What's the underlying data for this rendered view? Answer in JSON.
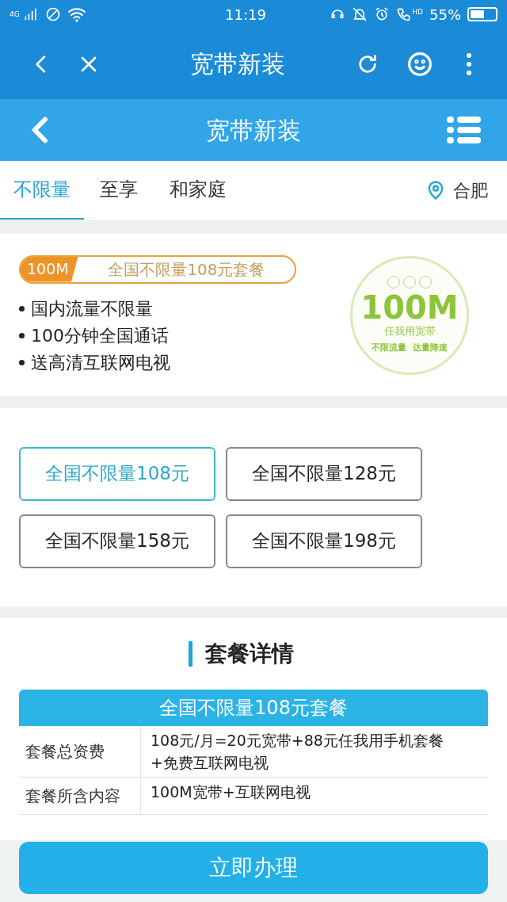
{
  "status_bar": {
    "network": "4G",
    "time": "11:19",
    "battery": "55%",
    "hd": "HD"
  },
  "app_bar": {
    "title": "宽带新装"
  },
  "page_header": {
    "title": "宽带新装"
  },
  "tabs": [
    {
      "label": "不限量",
      "selected": true
    },
    {
      "label": "至享",
      "selected": false
    },
    {
      "label": "和家庭",
      "selected": false
    }
  ],
  "location": "合肥",
  "banner": {
    "speed_tag": "100M",
    "plan_name": "全国不限量108元套餐",
    "features": [
      "国内流量不限量",
      "100分钟全国通话",
      "送高清互联网电视"
    ],
    "badge": {
      "speed": "100M",
      "slogan": "任我用宽带",
      "footer": "不限流量  达量降速"
    }
  },
  "plans": [
    {
      "label": "全国不限量108元",
      "selected": true
    },
    {
      "label": "全国不限量128元",
      "selected": false
    },
    {
      "label": "全国不限量158元",
      "selected": false
    },
    {
      "label": "全国不限量198元",
      "selected": false
    }
  ],
  "details": {
    "title": "套餐详情",
    "table_title": "全国不限量108元套餐",
    "rows": [
      {
        "label": "套餐总资费",
        "value": "108元/月=20元宽带+88元任我用手机套餐+免费互联网电视"
      },
      {
        "label": "套餐所含内容",
        "value": "100M宽带+互联网电视"
      }
    ]
  },
  "action_button": "立即办理"
}
